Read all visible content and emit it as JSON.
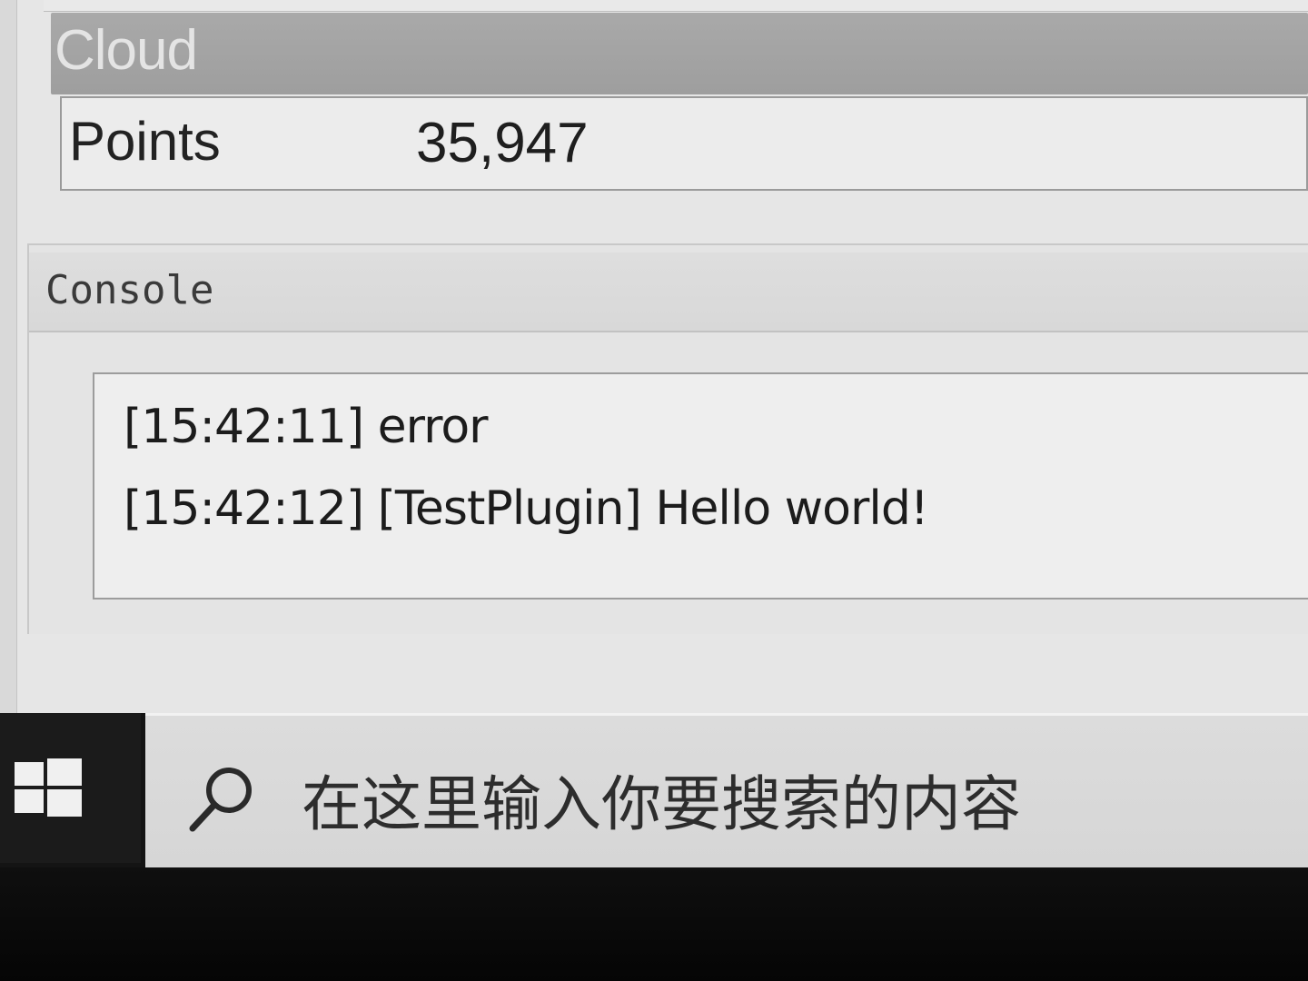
{
  "cloud": {
    "title": "Cloud",
    "points_label": "Points",
    "points_value": "35,947"
  },
  "console": {
    "title": "Console",
    "lines": [
      "[15:42:11] error",
      "[15:42:12] [TestPlugin] Hello world!"
    ]
  },
  "taskbar": {
    "start_icon": "windows-logo-icon",
    "search_icon": "search-icon",
    "search_placeholder": "在这里输入你要搜索的内容"
  }
}
